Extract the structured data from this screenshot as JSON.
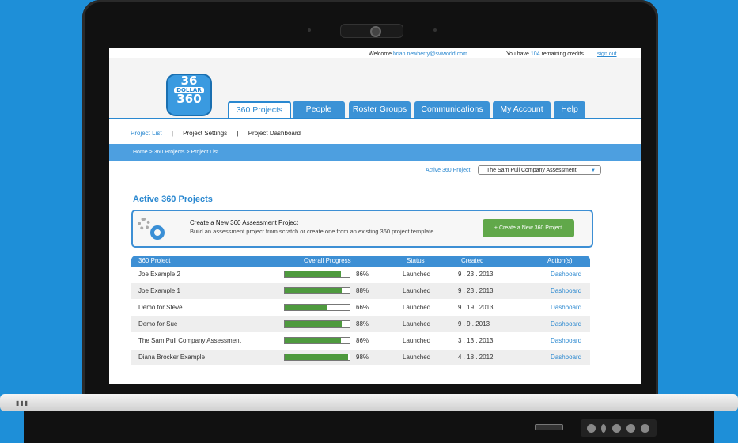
{
  "topbar": {
    "welcome_prefix": "Welcome ",
    "email": "brian.newberry@sviworld.com",
    "credits_prefix": "You have ",
    "credits_count": "104",
    "credits_suffix": " remaining credits",
    "separator": "|",
    "signout": "sign out"
  },
  "logo": {
    "top": "36",
    "middle": "DOLLAR",
    "bottom": "360"
  },
  "tabs": [
    "360 Projects",
    "People",
    "Roster Groups",
    "Communications",
    "My Account",
    "Help"
  ],
  "subnav": {
    "items": [
      "Project List",
      "Project Settings",
      "Project Dashboard"
    ],
    "separator": "|"
  },
  "breadcrumb": "Home  >  360 Projects  >  Project List",
  "project_select": {
    "label": "Active 360 Project",
    "value": "The Sam Pull Company Assessment"
  },
  "page_title": "Active 360 Projects",
  "create": {
    "title": "Create a New 360 Assessment Project",
    "desc": "Build an assessment project from scratch or create one from an existing 360 project template.",
    "button": "+ Create a New 360 Project"
  },
  "table": {
    "headers": [
      "360 Project",
      "Overall Progress",
      "Status",
      "Created",
      "Action(s)"
    ],
    "rows": [
      {
        "name": "Joe Example 2",
        "progress": 0.86,
        "pct": "86%",
        "status": "Launched",
        "created": "9 . 23 . 2013",
        "action": "Dashboard"
      },
      {
        "name": "Joe Example 1",
        "progress": 0.88,
        "pct": "88%",
        "status": "Launched",
        "created": "9 . 23 . 2013",
        "action": "Dashboard"
      },
      {
        "name": "Demo for Steve",
        "progress": 0.66,
        "pct": "66%",
        "status": "Launched",
        "created": "9 . 19 . 2013",
        "action": "Dashboard"
      },
      {
        "name": "Demo for Sue",
        "progress": 0.88,
        "pct": "88%",
        "status": "Launched",
        "created": "9 . 9 . 2013",
        "action": "Dashboard"
      },
      {
        "name": "The Sam Pull Company Assessment",
        "progress": 0.86,
        "pct": "86%",
        "status": "Launched",
        "created": "3 . 13 . 2013",
        "action": "Dashboard"
      },
      {
        "name": "Diana Brocker Example",
        "progress": 0.98,
        "pct": "98%",
        "status": "Launched",
        "created": "4 . 18 . 2012",
        "action": "Dashboard"
      }
    ]
  },
  "colors": {
    "accent": "#2a88d0",
    "progress": "#4e9a3e",
    "create_button": "#61a84a"
  }
}
